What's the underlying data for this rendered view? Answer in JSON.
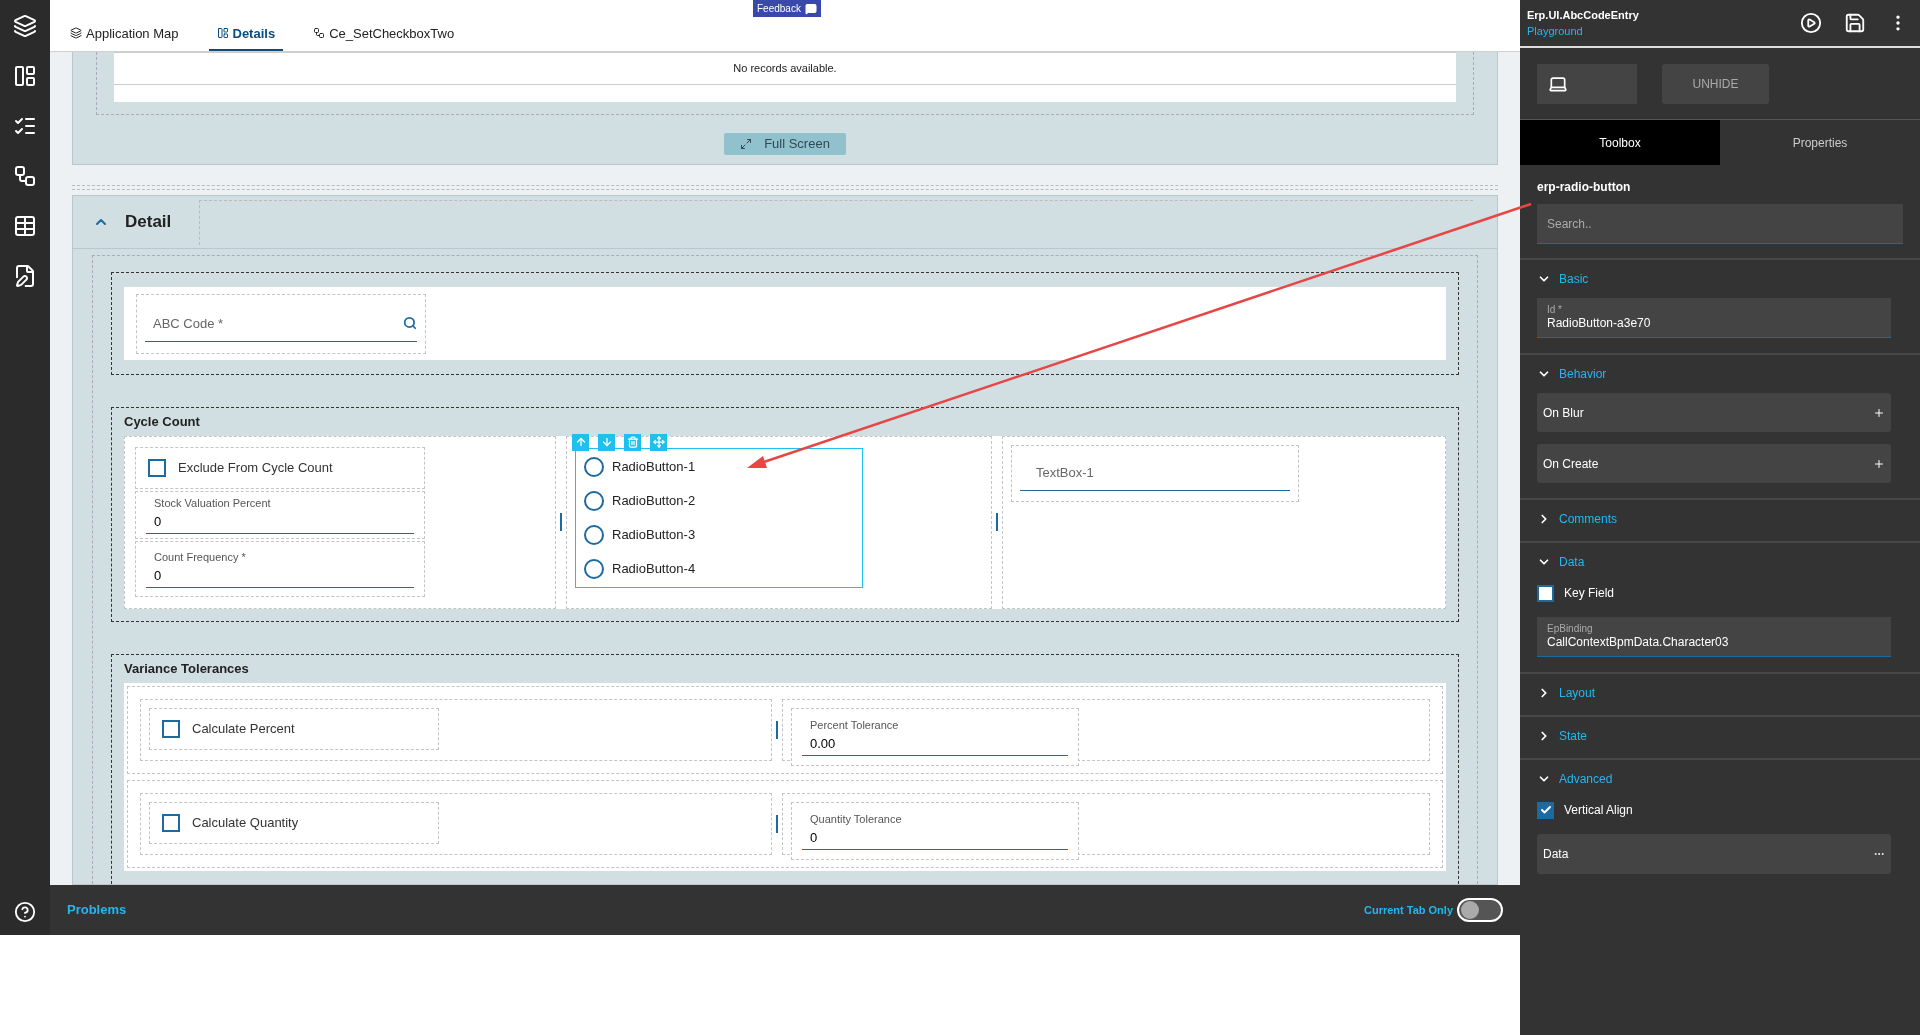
{
  "feedback": "Feedback",
  "tabs": [
    {
      "label": "Application Map",
      "selected": false
    },
    {
      "label": "Details",
      "selected": true
    },
    {
      "label": "Ce_SetCheckboxTwo",
      "selected": false
    }
  ],
  "grid": {
    "empty_message": "No records available.",
    "full_screen_button": "Full Screen"
  },
  "detail": {
    "title": "Detail",
    "expanded": true,
    "abc_code": {
      "placeholder": "ABC Code *"
    },
    "cycle_count": {
      "title": "Cycle Count",
      "exclude": {
        "label": "Exclude From Cycle Count",
        "checked": false
      },
      "fields": [
        {
          "label": "Stock Valuation Percent",
          "value": "0"
        },
        {
          "label": "Count Frequency *",
          "value": "0"
        }
      ],
      "radio_buttons": [
        {
          "label": "RadioButton-1",
          "selected": false
        },
        {
          "label": "RadioButton-2",
          "selected": false
        },
        {
          "label": "RadioButton-3",
          "selected": false
        },
        {
          "label": "RadioButton-4",
          "selected": false
        }
      ],
      "textbox": {
        "placeholder": "TextBox-1"
      }
    },
    "variance": {
      "title": "Variance Tolerances",
      "rows": [
        {
          "checkbox": {
            "label": "Calculate Percent",
            "checked": false
          },
          "field": {
            "label": "Percent Tolerance",
            "value": "0.00"
          }
        },
        {
          "checkbox": {
            "label": "Calculate Quantity",
            "checked": false
          },
          "field": {
            "label": "Quantity Tolerance",
            "value": "0"
          }
        }
      ]
    }
  },
  "bottom_bar": {
    "problems": "Problems",
    "toggle": {
      "label": "Current Tab Only",
      "on": false
    }
  },
  "panel": {
    "title": "Erp.UI.AbcCodeEntry",
    "subtitle": "Playground",
    "unhide": "UNHIDE",
    "tabs": [
      {
        "label": "Toolbox",
        "selected": true
      },
      {
        "label": "Properties",
        "selected": false
      }
    ],
    "component": "erp-radio-button",
    "search": {
      "placeholder": "Search.."
    },
    "sections": [
      {
        "title": "Basic",
        "expanded": true,
        "items": [
          {
            "kind": "field",
            "label": "Id *",
            "value": "RadioButton-a3e70"
          }
        ]
      },
      {
        "title": "Behavior",
        "expanded": true,
        "items": [
          {
            "kind": "event",
            "label": "On Blur"
          },
          {
            "kind": "event",
            "label": "On Create"
          }
        ]
      },
      {
        "title": "Comments",
        "expanded": false
      },
      {
        "title": "Data",
        "expanded": true,
        "items": [
          {
            "kind": "checkbox",
            "label": "Key Field",
            "checked": false
          },
          {
            "kind": "field",
            "label": "EpBinding",
            "value": "CallContextBpmData.Character03"
          }
        ]
      },
      {
        "title": "Layout",
        "expanded": false
      },
      {
        "title": "State",
        "expanded": false
      },
      {
        "title": "Advanced",
        "expanded": true,
        "items": [
          {
            "kind": "checkbox",
            "label": "Vertical Align",
            "checked": true
          },
          {
            "kind": "menu",
            "label": "Data"
          }
        ]
      }
    ]
  }
}
